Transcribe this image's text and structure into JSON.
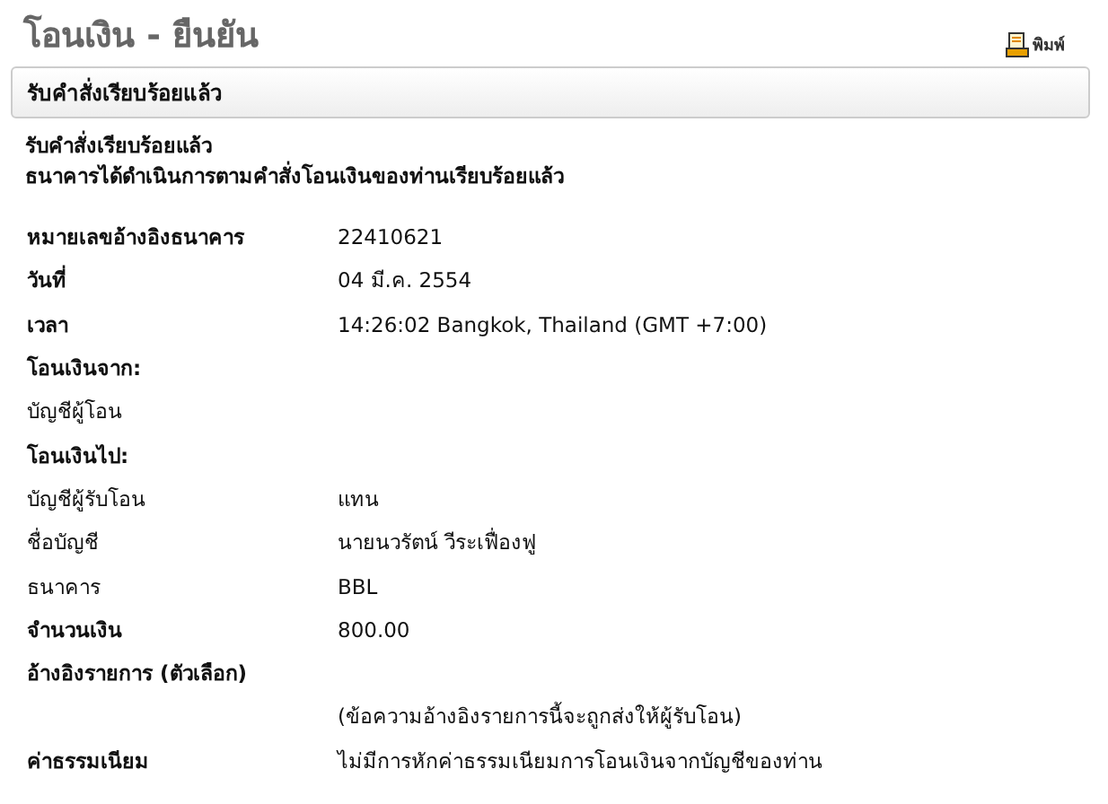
{
  "page": {
    "title": "โอนเงิน - ยืนยัน",
    "print_link": "พิมพ์"
  },
  "status_panel": {
    "title": "รับคำสั่งเรียบร้อยแล้ว"
  },
  "messages": [
    "รับคำสั่งเรียบร้อยแล้ว",
    "ธนาคารได้ดำเนินการตามคำสั่งโอนเงินของท่านเรียบร้อยแล้ว"
  ],
  "details": [
    {
      "kind": "main",
      "label": "หมายเลขอ้างอิงธนาคาร",
      "value": "22410621"
    },
    {
      "kind": "main",
      "label": "วันที่",
      "value": "04 มี.ค. 2554"
    },
    {
      "kind": "main",
      "label": "เวลา",
      "value": "14:26:02 Bangkok, Thailand (GMT +7:00)"
    },
    {
      "kind": "main",
      "label": "โอนเงินจาก:"
    },
    {
      "kind": "sub",
      "label": "บัญชีผู้โอน"
    },
    {
      "kind": "main",
      "label": "โอนเงินไป:"
    },
    {
      "kind": "sub",
      "label": "บัญชีผู้รับโอน",
      "value": "แทน"
    },
    {
      "kind": "sub",
      "label": "ชื่อบัญชี",
      "value": "นายนวรัตน์ วีระเฟื่องฟู"
    },
    {
      "kind": "sub",
      "label": "ธนาคาร",
      "value": "BBL"
    },
    {
      "kind": "main",
      "label": "จำนวนเงิน",
      "value": "800.00"
    },
    {
      "kind": "main",
      "label": "อ้างอิงรายการ (ตัวเลือก)"
    },
    {
      "kind": "sub",
      "value": "(ข้อความอ้างอิงรายการนี้จะถูกส่งให้ผู้รับโอน)"
    },
    {
      "kind": "main",
      "label": "ค่าธรรมเนียม",
      "value": "ไม่มีการหักค่าธรรมเนียมการโอนเงินจากบัญชีของท่าน"
    }
  ]
}
